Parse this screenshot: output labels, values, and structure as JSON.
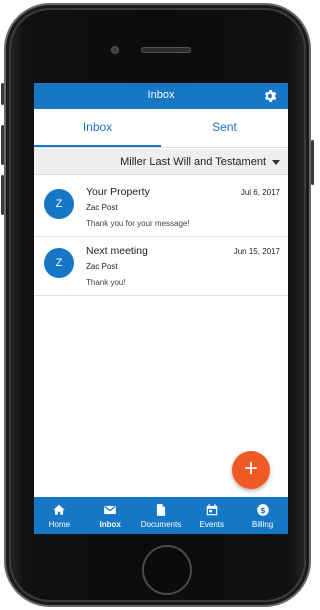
{
  "app": {
    "title": "Inbox"
  },
  "tabs": [
    {
      "label": "Inbox",
      "active": true
    },
    {
      "label": "Sent",
      "active": false
    }
  ],
  "filter": {
    "selected": "Miller Last Will and Testament"
  },
  "messages": [
    {
      "avatar": "Z",
      "subject": "Your Property",
      "date": "Jul 6, 2017",
      "sender": "Zac Post",
      "preview": "Thank you for your message!"
    },
    {
      "avatar": "Z",
      "subject": "Next meeting",
      "date": "Jun 15, 2017",
      "sender": "Zac Post",
      "preview": "Thank you!"
    }
  ],
  "fab": {
    "symbol": "+"
  },
  "bottom_nav": [
    {
      "label": "Home",
      "icon": "home-icon"
    },
    {
      "label": "Inbox",
      "icon": "mail-icon",
      "active": true
    },
    {
      "label": "Documents",
      "icon": "document-icon"
    },
    {
      "label": "Events",
      "icon": "calendar-icon"
    },
    {
      "label": "Billing",
      "icon": "dollar-icon"
    }
  ],
  "colors": {
    "primary": "#1677c7",
    "fab": "#f15a24",
    "filter_bg": "#efefef"
  }
}
